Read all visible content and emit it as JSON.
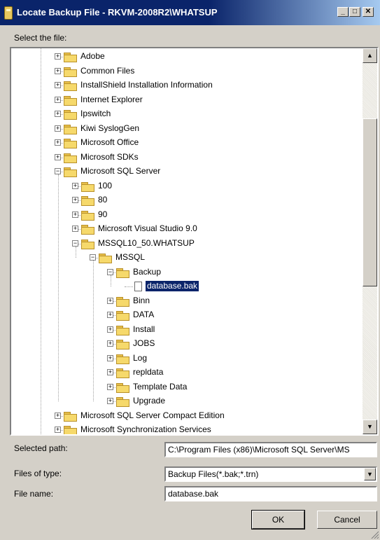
{
  "window": {
    "title": "Locate Backup File - RKVM-2008R2\\WHATSUP"
  },
  "title_buttons": {
    "minimize": "_",
    "maximize": "□",
    "close": "✕"
  },
  "labels": {
    "select_file": "Select the file:"
  },
  "tree": {
    "nodes": [
      {
        "label": "Adobe",
        "level": 0,
        "expander": "+"
      },
      {
        "label": "Common Files",
        "level": 0,
        "expander": "+"
      },
      {
        "label": "InstallShield Installation Information",
        "level": 0,
        "expander": "+"
      },
      {
        "label": "Internet Explorer",
        "level": 0,
        "expander": "+"
      },
      {
        "label": "Ipswitch",
        "level": 0,
        "expander": "+"
      },
      {
        "label": "Kiwi SyslogGen",
        "level": 0,
        "expander": "+"
      },
      {
        "label": "Microsoft Office",
        "level": 0,
        "expander": "+"
      },
      {
        "label": "Microsoft SDKs",
        "level": 0,
        "expander": "+"
      },
      {
        "label": "Microsoft SQL Server",
        "level": 0,
        "expander": "−"
      },
      {
        "label": "100",
        "level": 1,
        "expander": "+"
      },
      {
        "label": "80",
        "level": 1,
        "expander": "+"
      },
      {
        "label": "90",
        "level": 1,
        "expander": "+"
      },
      {
        "label": "Microsoft Visual Studio 9.0",
        "level": 1,
        "expander": "+"
      },
      {
        "label": "MSSQL10_50.WHATSUP",
        "level": 1,
        "expander": "−"
      },
      {
        "label": "MSSQL",
        "level": 2,
        "expander": "−"
      },
      {
        "label": "Backup",
        "level": 3,
        "expander": "−"
      },
      {
        "label": "database.bak",
        "level": 4,
        "expander": "",
        "type": "file",
        "selected": true
      },
      {
        "label": "Binn",
        "level": 3,
        "expander": "+"
      },
      {
        "label": "DATA",
        "level": 3,
        "expander": "+"
      },
      {
        "label": "Install",
        "level": 3,
        "expander": "+"
      },
      {
        "label": "JOBS",
        "level": 3,
        "expander": "+"
      },
      {
        "label": "Log",
        "level": 3,
        "expander": "+"
      },
      {
        "label": "repldata",
        "level": 3,
        "expander": "+"
      },
      {
        "label": "Template Data",
        "level": 3,
        "expander": "+"
      },
      {
        "label": "Upgrade",
        "level": 3,
        "expander": "+"
      },
      {
        "label": "Microsoft SQL Server Compact Edition",
        "level": 0,
        "expander": "+"
      },
      {
        "label": "Microsoft Synchronization Services",
        "level": 0,
        "expander": "+"
      }
    ]
  },
  "scrollbar": {
    "up": "▲",
    "down": "▼"
  },
  "form": {
    "selected_path_label": "Selected path:",
    "selected_path_value": "C:\\Program Files (x86)\\Microsoft SQL Server\\MS",
    "files_of_type_label": "Files of type:",
    "files_of_type_value": "Backup Files(*.bak;*.trn)",
    "file_name_label": "File name:",
    "file_name_value": "database.bak",
    "combo_arrow": "▼"
  },
  "buttons": {
    "ok": "OK",
    "cancel": "Cancel"
  },
  "colors": {
    "title_bar": "#0a246a",
    "selection": "#0a246a",
    "dialog_bg": "#d4d0c8",
    "folder": "#f6d96b"
  },
  "icons": {
    "title": "backup-file-icon",
    "folder": "folder-icon",
    "file": "document-icon"
  }
}
